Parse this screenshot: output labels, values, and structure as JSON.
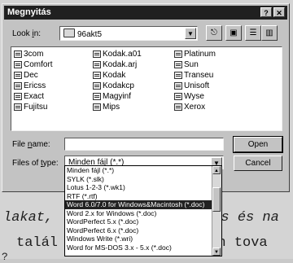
{
  "dialog": {
    "title": "Megnyitás",
    "help_glyph": "?",
    "close_glyph": "✕"
  },
  "look_in": {
    "label_prefix": "Look ",
    "label_access": "i",
    "label_suffix": "n:",
    "value": "96akt5",
    "arrow": "▼"
  },
  "toolbar": {
    "up_folder_icon": "⎋",
    "new_folder_icon": "▣",
    "list_view_icon": "☰",
    "details_view_icon": "▥"
  },
  "files": {
    "columns": [
      [
        "3com",
        "Comfort",
        "Dec",
        "Ericss",
        "Exact",
        "Fujitsu"
      ],
      [
        "Kodak.a01",
        "Kodak.arj",
        "Kodak",
        "Kodakcp",
        "Magyinf",
        "Mips"
      ],
      [
        "Platinum",
        "Sun",
        "Transeu",
        "Unisoft",
        "Wyse",
        "Xerox"
      ]
    ]
  },
  "file_name": {
    "label_prefix": "File ",
    "label_access": "n",
    "label_suffix": "ame:",
    "value": ""
  },
  "file_type": {
    "label_prefix": "Files of ",
    "label_access": "t",
    "label_suffix": "ype:",
    "value": "Minden fájl (*.*)",
    "arrow": "▼",
    "options": [
      "Minden fájl (*.*)",
      "SYLK (*.slk)",
      "Lotus 1-2-3 (*.wk1)",
      "RTF (*.rtf)",
      "Word 6.0/7.0 for Windows&Macintosh (*.doc)",
      "Word 2.x for Windows (*.doc)",
      "WordPerfect 5.x (*.doc)",
      "WordPerfect 6.x (*.doc)",
      "Windows Write (*.wri)",
      "Word for MS-DOS 3.x - 5.x (*.doc)"
    ],
    "selected_index": 4
  },
  "buttons": {
    "open": "Open",
    "cancel": "Cancel"
  },
  "background": {
    "line1": "lakat,",
    "line1b": "ás és na",
    "line2": "talál",
    "line2b": "ban tova",
    "line3": "?"
  }
}
